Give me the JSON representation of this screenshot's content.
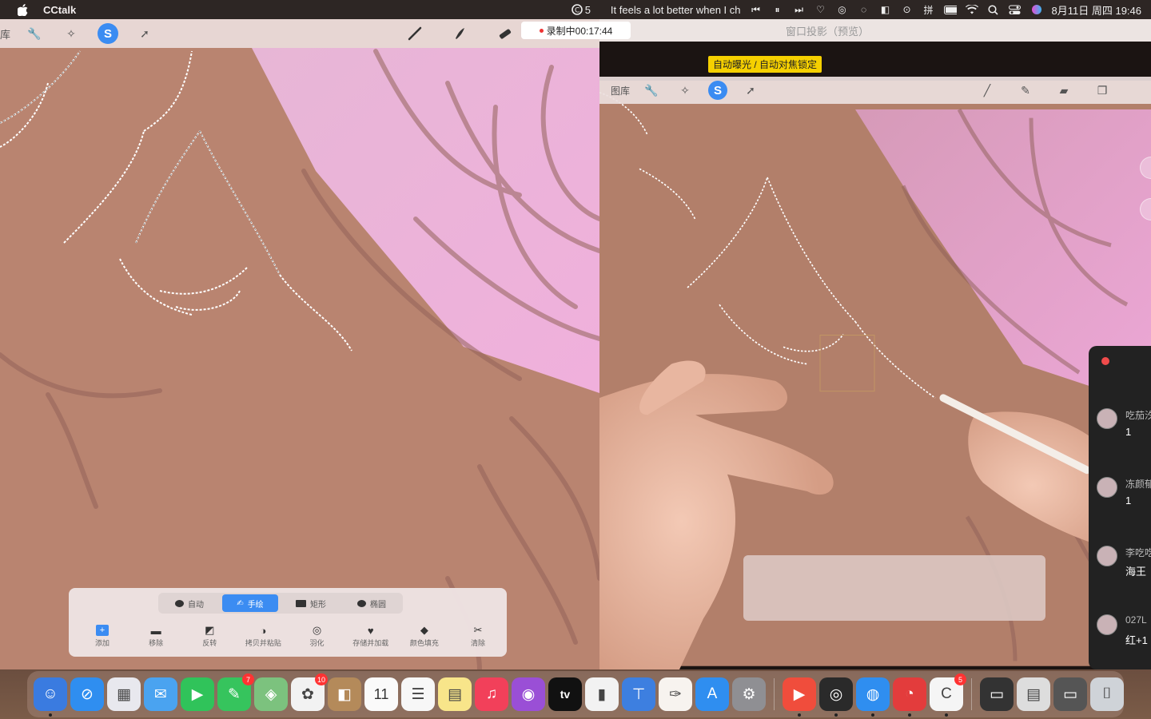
{
  "menubar": {
    "app_name": "CCtalk",
    "status_count": "5",
    "now_playing": "It feels a lot better when I ch",
    "datetime": "8月11日 周四  19:46"
  },
  "left_window": {
    "toolbar": {
      "gallery": "库"
    },
    "recording": "录制中00:17:44",
    "selection": {
      "modes": [
        "自动",
        "手绘",
        "矩形",
        "椭圆"
      ],
      "active_mode": "手绘",
      "actions": [
        "添加",
        "移除",
        "反转",
        "拷贝并粘贴",
        "羽化",
        "存储并加载",
        "颜色填充",
        "清除"
      ]
    }
  },
  "right_window": {
    "title": "窗口投影（预览）",
    "camera_badge": "自动曝光 / 自动对焦锁定",
    "ipad_toolbar": {
      "gallery": "图库"
    },
    "chat": [
      {
        "name": "吃茄汐",
        "msg": "1"
      },
      {
        "name": "冻颜郁",
        "msg": "1"
      },
      {
        "name": "李吃吃",
        "msg": "海王"
      },
      {
        "name": "027L",
        "msg": "红+1"
      }
    ]
  },
  "dock": {
    "apps": [
      {
        "name": "finder",
        "color": "#3a7be0",
        "glyph": "☺",
        "running": true
      },
      {
        "name": "safari",
        "color": "#2f8ef0",
        "glyph": "⊘",
        "running": false
      },
      {
        "name": "launchpad",
        "color": "#e8e8ee",
        "glyph": "▦",
        "running": false
      },
      {
        "name": "mail",
        "color": "#4aa3f0",
        "glyph": "✉",
        "running": false
      },
      {
        "name": "facetime",
        "color": "#30c35a",
        "glyph": "▶",
        "running": false
      },
      {
        "name": "messages",
        "color": "#36c45d",
        "glyph": "✎",
        "running": false,
        "badge": "7"
      },
      {
        "name": "maps",
        "color": "#7cc27e",
        "glyph": "◈",
        "running": false
      },
      {
        "name": "photos",
        "color": "#f2f2f2",
        "glyph": "✿",
        "running": false,
        "badge": "10"
      },
      {
        "name": "contacts",
        "color": "#b48a5a",
        "glyph": "◧",
        "running": false
      },
      {
        "name": "calendar",
        "color": "#fafafa",
        "glyph": "11",
        "running": false
      },
      {
        "name": "reminders",
        "color": "#f7f7f7",
        "glyph": "☰",
        "running": false
      },
      {
        "name": "notes",
        "color": "#f8e58a",
        "glyph": "▤",
        "running": false
      },
      {
        "name": "music",
        "color": "#f2405a",
        "glyph": "♫",
        "running": false
      },
      {
        "name": "podcasts",
        "color": "#9a4fd6",
        "glyph": "◉",
        "running": false
      },
      {
        "name": "tv",
        "color": "#111",
        "glyph": "tv",
        "running": false
      },
      {
        "name": "numbers",
        "color": "#f2f2f2",
        "glyph": "▮",
        "running": false
      },
      {
        "name": "keynote",
        "color": "#3d7fe0",
        "glyph": "⊤",
        "running": false
      },
      {
        "name": "pages",
        "color": "#f7f3ef",
        "glyph": "✑",
        "running": false
      },
      {
        "name": "app-store",
        "color": "#2f8ef0",
        "glyph": "A",
        "running": false
      },
      {
        "name": "system-preferences",
        "color": "#8f8f93",
        "glyph": "⚙",
        "running": false
      },
      {
        "name": "sep",
        "color": "",
        "glyph": "",
        "running": false
      },
      {
        "name": "video-app",
        "color": "#f04d3c",
        "glyph": "▶",
        "running": true
      },
      {
        "name": "obs",
        "color": "#2a2a2a",
        "glyph": "◎",
        "running": true
      },
      {
        "name": "camera-app",
        "color": "#2f8ef0",
        "glyph": "◍",
        "running": true
      },
      {
        "name": "netease-music",
        "color": "#e33c3c",
        "glyph": "◔",
        "running": true
      },
      {
        "name": "cctalk",
        "color": "#f5f5f5",
        "glyph": "C",
        "running": true,
        "badge": "5"
      },
      {
        "name": "sep",
        "color": "",
        "glyph": "",
        "running": false
      },
      {
        "name": "window-1",
        "color": "#333",
        "glyph": "▭",
        "running": false
      },
      {
        "name": "window-2",
        "color": "#ddd",
        "glyph": "▤",
        "running": false
      },
      {
        "name": "window-3",
        "color": "#555",
        "glyph": "▭",
        "running": false
      },
      {
        "name": "trash",
        "color": "#cfd3d8",
        "glyph": "⌷",
        "running": false
      }
    ]
  }
}
